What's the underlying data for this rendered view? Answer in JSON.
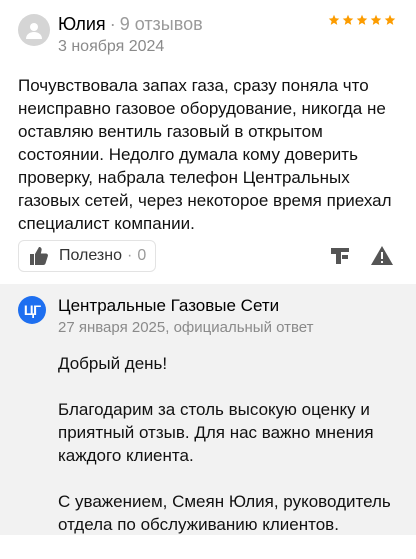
{
  "review": {
    "author": "Юлия",
    "reviews_count": "9 отзывов",
    "date": "3 ноября 2024",
    "rating": 5,
    "text": "Почувствовала запах газа, сразу поняла что неисправно газовое оборудование, никогда не оставляю вентиль газовый в открытом состоянии. Недолго думала кому доверить проверку, набрала телефон Центральных газовых сетей, через некоторое время приехал специалист компании.",
    "useful_label": "Полезно",
    "useful_count": "0",
    "colors": {
      "star": "#fc9c00",
      "icon": "#555555"
    },
    "icons": {
      "avatar": "user-icon",
      "useful": "thumbs-up-icon",
      "share": "share-icon",
      "report": "warning-icon"
    }
  },
  "reply": {
    "logo_text": "ЦГ",
    "company": "Центральные Газовые Сети",
    "date_line": "27 января 2025, официальный ответ",
    "paragraphs": [
      "Добрый день!",
      "Благодарим за столь высокую оценку и приятный отзыв. Для нас важно мнения каждого клиента.",
      "С уважением, Смеян Юлия, руководитель отдела по обслуживанию клиентов."
    ],
    "colors": {
      "logo_bg": "#1e6ff0",
      "background": "#f2f2f2"
    }
  }
}
